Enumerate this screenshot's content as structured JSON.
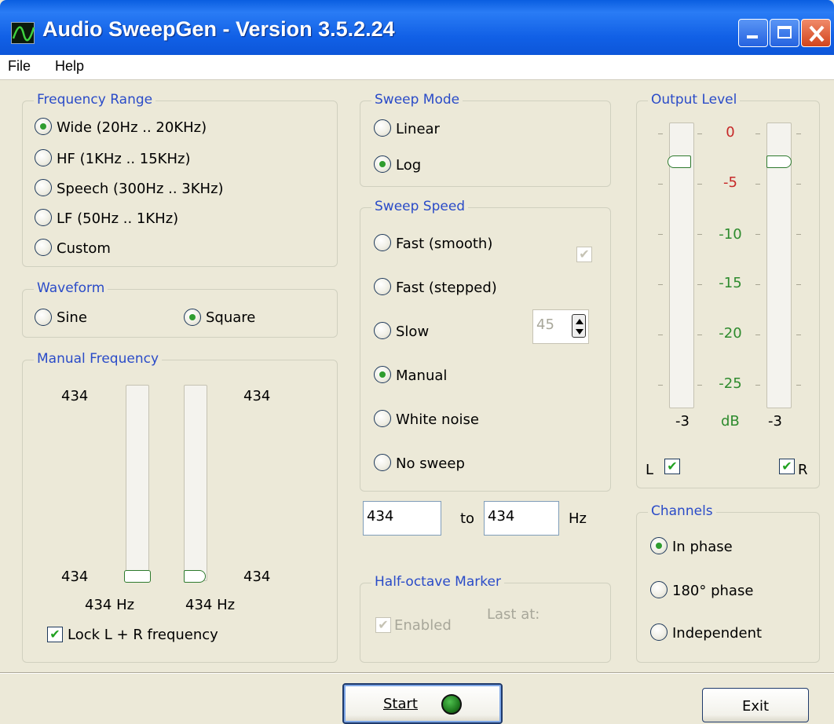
{
  "window": {
    "title": "Audio SweepGen - Version 3.5.2.24"
  },
  "menu": {
    "file": "File",
    "help": "Help"
  },
  "frequency_range": {
    "title": "Frequency Range",
    "options": [
      {
        "label": "Wide  (20Hz .. 20KHz)",
        "selected": true
      },
      {
        "label": "HF  (1KHz .. 15KHz)",
        "selected": false
      },
      {
        "label": "Speech  (300Hz .. 3KHz)",
        "selected": false
      },
      {
        "label": "LF  (50Hz .. 1KHz)",
        "selected": false
      },
      {
        "label": "Custom",
        "selected": false
      }
    ]
  },
  "waveform": {
    "title": "Waveform",
    "options": [
      {
        "label": "Sine",
        "selected": false
      },
      {
        "label": "Square",
        "selected": true
      }
    ]
  },
  "manual_frequency": {
    "title": "Manual Frequency",
    "left_top": "434",
    "right_top": "434",
    "left_bottom": "434",
    "right_bottom": "434",
    "left_hz": "434 Hz",
    "right_hz": "434 Hz",
    "lock_label": "Lock L + R frequency",
    "lock_checked": true
  },
  "sweep_mode": {
    "title": "Sweep Mode",
    "options": [
      {
        "label": "Linear",
        "selected": false
      },
      {
        "label": "Log",
        "selected": true
      }
    ]
  },
  "sweep_speed": {
    "title": "Sweep Speed",
    "options": [
      {
        "label": "Fast (smooth)",
        "selected": false
      },
      {
        "label": "Fast (stepped)",
        "selected": false
      },
      {
        "label": "Slow",
        "selected": false
      },
      {
        "label": "Manual",
        "selected": true
      },
      {
        "label": "White noise",
        "selected": false
      },
      {
        "label": "No sweep",
        "selected": false
      }
    ],
    "slow_value": "45",
    "smooth_checked": true
  },
  "range": {
    "from": "434",
    "to_label": "to",
    "to": "434",
    "unit": "Hz"
  },
  "half_octave": {
    "title": "Half-octave Marker",
    "enabled_label": "Enabled",
    "last_at": "Last at:"
  },
  "output_level": {
    "title": "Output Level",
    "scale": [
      "0",
      "-5",
      "-10",
      "-15",
      "-20",
      "-25"
    ],
    "scale_colors": [
      "#c62828",
      "#c62828",
      "#2e8b2e",
      "#2e8b2e",
      "#2e8b2e",
      "#2e8b2e"
    ],
    "left_value": "-3",
    "unit": "dB",
    "right_value": "-3",
    "left_label": "L",
    "right_label": "R",
    "left_checked": true,
    "right_checked": true
  },
  "channels": {
    "title": "Channels",
    "options": [
      {
        "label": "In phase",
        "selected": true
      },
      {
        "label": "180° phase",
        "selected": false
      },
      {
        "label": "Independent",
        "selected": false
      }
    ]
  },
  "buttons": {
    "start": "Start",
    "exit": "Exit"
  },
  "colors": {
    "accent": "#2a4bc8",
    "led": "#1f7a1f"
  }
}
